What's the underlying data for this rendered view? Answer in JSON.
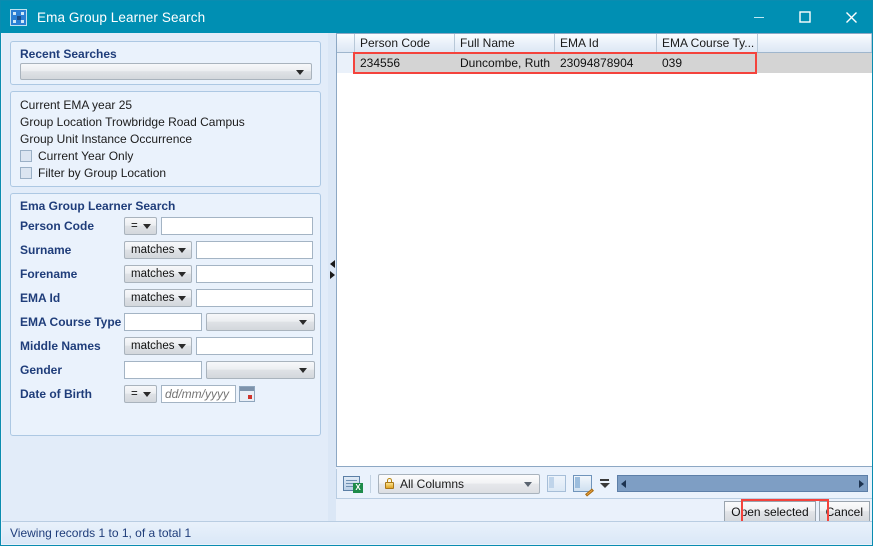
{
  "window": {
    "title": "Ema Group Learner Search",
    "icon": "app-grid-icon",
    "minimize_label": "–",
    "maximize_label": "□",
    "close_label": "✕"
  },
  "recent_searches": {
    "title": "Recent Searches",
    "combo_value": "",
    "combo_placeholder": ""
  },
  "info_panel": {
    "line1": "Current EMA year  25",
    "line2": "Group Location  Trowbridge Road Campus",
    "line3": "Group Unit Instance Occurrence",
    "checkbox1": {
      "label": "Current Year Only",
      "checked": false
    },
    "checkbox2": {
      "label": "Filter by Group Location",
      "checked": false
    }
  },
  "search_panel": {
    "title": "Ema Group Learner Search",
    "rows": [
      {
        "label": "Person Code",
        "operator": "=",
        "op_type": "eq",
        "value": "",
        "control": "text"
      },
      {
        "label": "Surname",
        "operator": "matches",
        "op_type": "matches",
        "value": "",
        "control": "text"
      },
      {
        "label": "Forename",
        "operator": "matches",
        "op_type": "matches",
        "value": "",
        "control": "text"
      },
      {
        "label": "EMA Id",
        "operator": "matches",
        "op_type": "matches",
        "value": "",
        "control": "text"
      },
      {
        "label": "EMA Course Type",
        "operator": "",
        "op_type": "none",
        "value": "",
        "control": "text-and-combo",
        "combo_value": ""
      },
      {
        "label": "Middle Names",
        "operator": "matches",
        "op_type": "matches",
        "value": "",
        "control": "text"
      },
      {
        "label": "Gender",
        "operator": "",
        "op_type": "none",
        "value": "",
        "control": "text-and-combo",
        "combo_value": ""
      },
      {
        "label": "Date of Birth",
        "operator": "=",
        "op_type": "eq",
        "value": "",
        "control": "date",
        "date_placeholder": "dd/mm/yyyy"
      }
    ]
  },
  "grid": {
    "columns": [
      "Person Code",
      "Full Name",
      "EMA Id",
      "EMA Course Ty..."
    ],
    "rows": [
      {
        "cells": [
          "234556",
          "Duncombe, Ruth",
          "23094878904",
          "039"
        ],
        "selected": true,
        "highlighted": true
      }
    ]
  },
  "grid_toolbar": {
    "export_icon": "export-to-excel-icon",
    "columns_filter": {
      "icon": "lock-icon",
      "value": "All Columns"
    },
    "layout_button_icon": "column-layout-icon",
    "edit_layout_button_icon": "edit-layout-icon",
    "more_icon": "more-options-icon",
    "scroll_left_icon": "scroll-left-arrow-icon",
    "scroll_right_icon": "scroll-right-arrow-icon"
  },
  "actions": {
    "open_selected": "Open selected",
    "cancel": "Cancel"
  },
  "statusbar": {
    "text": "Viewing records 1 to 1, of a total 1"
  },
  "splitter": {
    "collapse_icon": "collapse-left-icon",
    "expand_icon": "expand-right-icon"
  },
  "colors": {
    "title_bar": "#008fb3",
    "accent_label": "#1f3d7a",
    "highlight_border": "#f4433c",
    "panel_bg": "#eaf2fc",
    "selected_row": "#d4d4d4"
  }
}
